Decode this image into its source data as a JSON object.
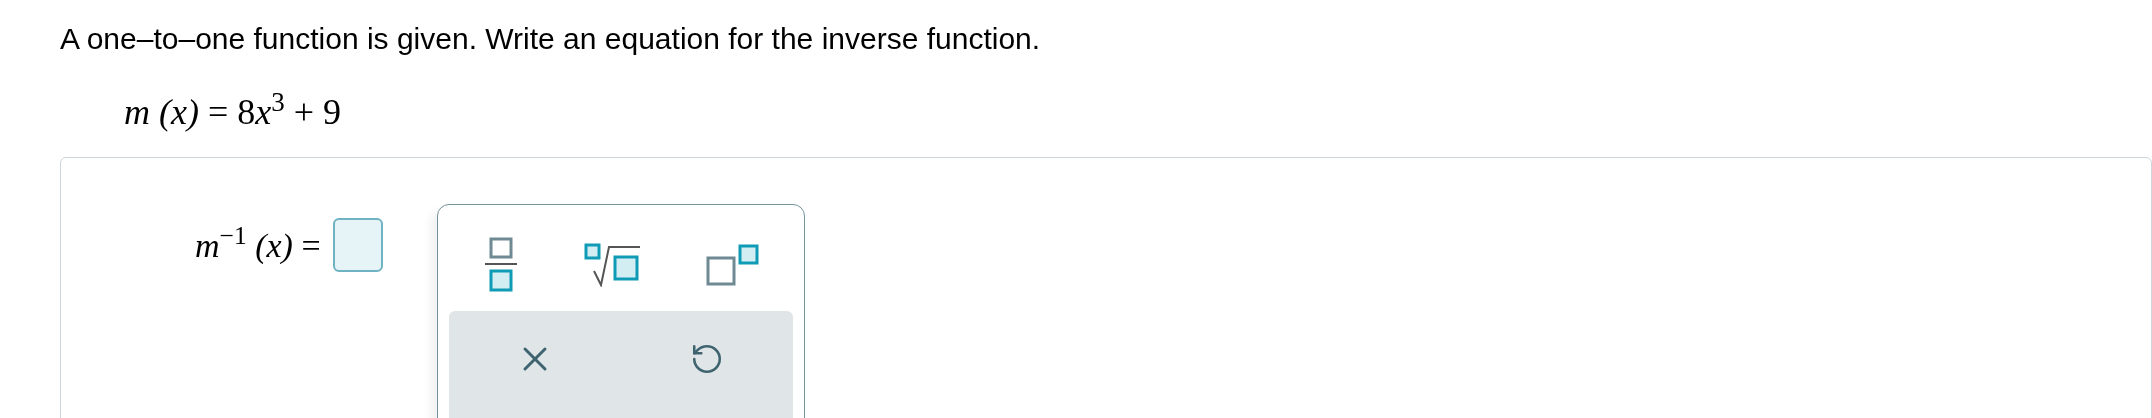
{
  "question": "A one–to–one function is given. Write an equation for the inverse function.",
  "given_equation": {
    "name": "m",
    "argument": "(x)",
    "equals": "=",
    "coefficient": "8",
    "variable": "x",
    "exponent": "3",
    "constant": "+ 9"
  },
  "answer": {
    "name": "m",
    "exponent": "−1",
    "argument": "(x)",
    "equals": "="
  },
  "palette": {
    "tools": [
      {
        "kind": "fraction"
      },
      {
        "kind": "root"
      },
      {
        "kind": "exponent"
      }
    ],
    "actions": [
      {
        "kind": "clear"
      },
      {
        "kind": "undo"
      }
    ]
  }
}
